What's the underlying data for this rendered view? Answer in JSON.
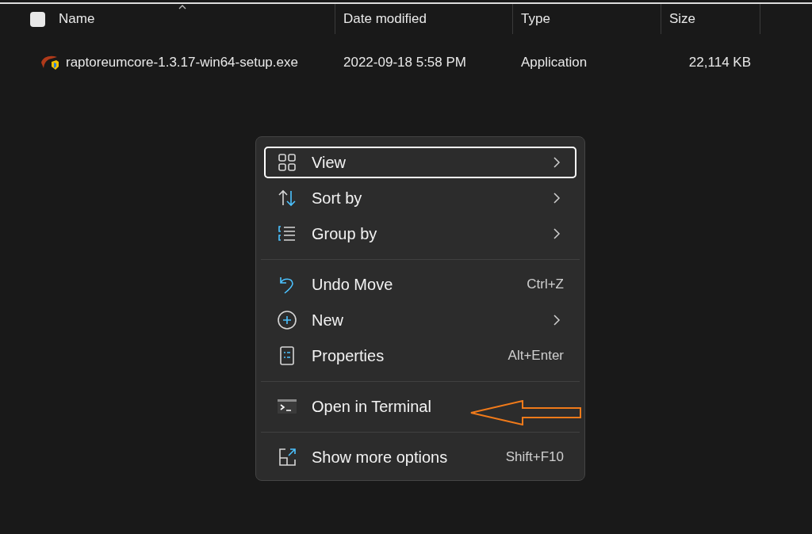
{
  "header": {
    "checked": false,
    "columns": [
      {
        "label": "Name",
        "sorted": true
      },
      {
        "label": "Date modified",
        "sorted": false
      },
      {
        "label": "Type",
        "sorted": false
      },
      {
        "label": "Size",
        "sorted": false
      }
    ]
  },
  "files": [
    {
      "name": "raptoreumcore-1.3.17-win64-setup.exe",
      "date": "2022-09-18 5:58 PM",
      "type": "Application",
      "size": "22,114 KB"
    }
  ],
  "context_menu": {
    "groups": [
      [
        {
          "kind": "grid",
          "label": "View",
          "submenu": true,
          "selected": true
        },
        {
          "kind": "sort",
          "label": "Sort by",
          "submenu": true,
          "selected": false
        },
        {
          "kind": "group",
          "label": "Group by",
          "submenu": true,
          "selected": false
        }
      ],
      [
        {
          "kind": "undo",
          "label": "Undo Move",
          "shortcut": "Ctrl+Z",
          "selected": false
        },
        {
          "kind": "plus",
          "label": "New",
          "submenu": true,
          "selected": false
        },
        {
          "kind": "properties",
          "label": "Properties",
          "shortcut": "Alt+Enter",
          "selected": false
        }
      ],
      [
        {
          "kind": "terminal",
          "label": "Open in Terminal",
          "selected": false,
          "annotated": true
        }
      ],
      [
        {
          "kind": "expand",
          "label": "Show more options",
          "shortcut": "Shift+F10",
          "selected": false
        }
      ]
    ]
  }
}
